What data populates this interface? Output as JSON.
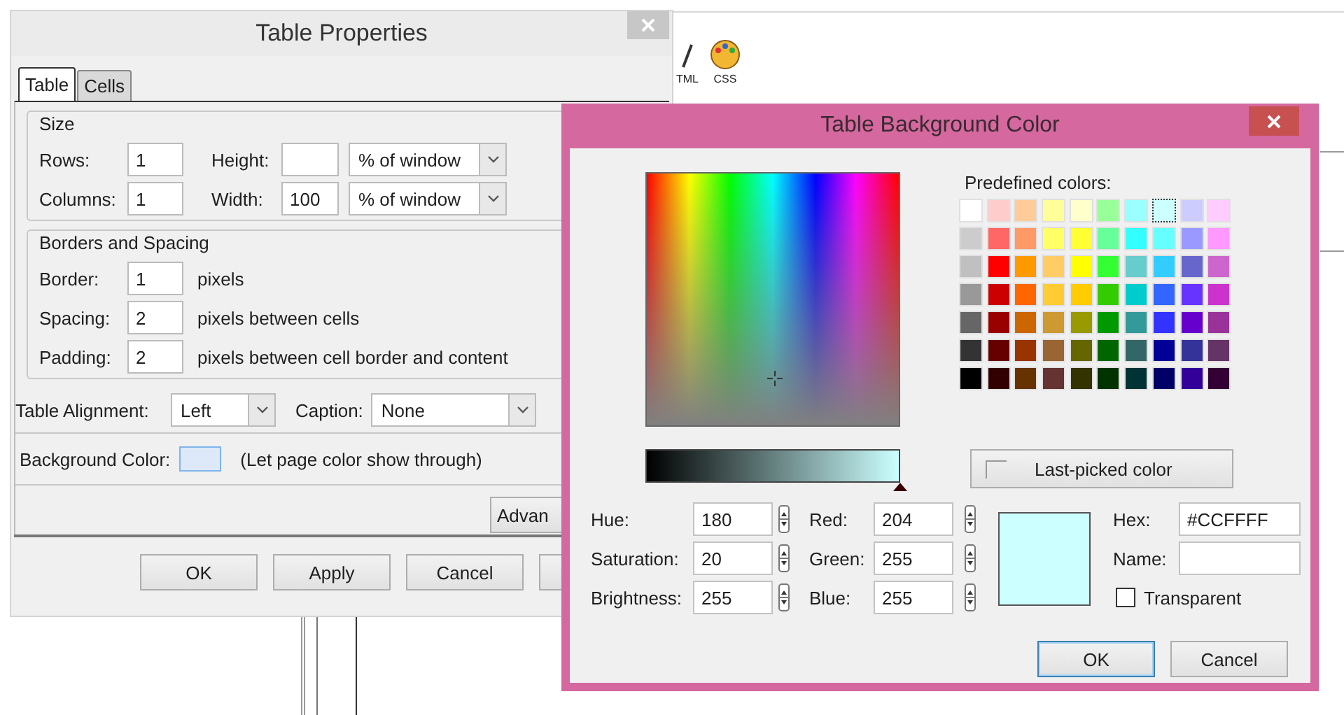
{
  "app": {
    "toolbar": [
      {
        "label": "TML",
        "kind": "html"
      },
      {
        "label": "CSS",
        "kind": "css"
      }
    ]
  },
  "table_properties": {
    "title": "Table Properties",
    "tabs": [
      {
        "label": "Table",
        "selected": true
      },
      {
        "label": "Cells",
        "selected": false
      }
    ],
    "size": {
      "title": "Size",
      "rows": [
        {
          "label": "Rows:",
          "value": "1",
          "dim_label": "Height:",
          "unit": "% of window"
        },
        {
          "label": "Columns:",
          "value": "1",
          "dim_label": "Width:",
          "dim_value": "100",
          "unit": "% of window"
        }
      ]
    },
    "borders": {
      "title": "Borders and Spacing",
      "rows": [
        {
          "label": "Border:",
          "value": "1",
          "note": "pixels"
        },
        {
          "label": "Spacing:",
          "value": "2",
          "note": "pixels between cells"
        },
        {
          "label": "Padding:",
          "value": "2",
          "note": "pixels between cell border and content"
        }
      ]
    },
    "alignment": {
      "label": "Table Alignment:",
      "value": "Left"
    },
    "caption": {
      "label": "Caption:",
      "value": "None"
    },
    "background": {
      "label": "Background Color:",
      "color": "#dde9f8",
      "note": "(Let page color show through)"
    },
    "advanced_button": "Advan",
    "buttons": [
      "OK",
      "Apply",
      "Cancel"
    ]
  },
  "color_dialog": {
    "title": "Table Background Color",
    "predefined_label": "Predefined colors:",
    "swatches": [
      {
        "color": "#ffffff",
        "selected": false
      },
      {
        "color": "#ffcccc",
        "selected": false
      },
      {
        "color": "#ffcc99",
        "selected": false
      },
      {
        "color": "#ffff99",
        "selected": false
      },
      {
        "color": "#ffffcc",
        "selected": false
      },
      {
        "color": "#99ff99",
        "selected": false
      },
      {
        "color": "#99ffff",
        "selected": false
      },
      {
        "color": "#ccffff",
        "selected": true
      },
      {
        "color": "#ccccff",
        "selected": false
      },
      {
        "color": "#ffccff",
        "selected": false
      },
      {
        "color": "#cccccc",
        "selected": false
      },
      {
        "color": "#ff6666",
        "selected": false
      },
      {
        "color": "#ff9966",
        "selected": false
      },
      {
        "color": "#ffff66",
        "selected": false
      },
      {
        "color": "#ffff33",
        "selected": false
      },
      {
        "color": "#66ff99",
        "selected": false
      },
      {
        "color": "#33ffff",
        "selected": false
      },
      {
        "color": "#66ffff",
        "selected": false
      },
      {
        "color": "#9999ff",
        "selected": false
      },
      {
        "color": "#ff99ff",
        "selected": false
      },
      {
        "color": "#c0c0c0",
        "selected": false
      },
      {
        "color": "#ff0000",
        "selected": false
      },
      {
        "color": "#ff9900",
        "selected": false
      },
      {
        "color": "#ffcc66",
        "selected": false
      },
      {
        "color": "#ffff00",
        "selected": false
      },
      {
        "color": "#33ff33",
        "selected": false
      },
      {
        "color": "#66cccc",
        "selected": false
      },
      {
        "color": "#33ccff",
        "selected": false
      },
      {
        "color": "#6666cc",
        "selected": false
      },
      {
        "color": "#cc66cc",
        "selected": false
      },
      {
        "color": "#999999",
        "selected": false
      },
      {
        "color": "#cc0000",
        "selected": false
      },
      {
        "color": "#ff6600",
        "selected": false
      },
      {
        "color": "#ffcc33",
        "selected": false
      },
      {
        "color": "#ffcc00",
        "selected": false
      },
      {
        "color": "#33cc00",
        "selected": false
      },
      {
        "color": "#00cccc",
        "selected": false
      },
      {
        "color": "#3366ff",
        "selected": false
      },
      {
        "color": "#6633ff",
        "selected": false
      },
      {
        "color": "#cc33cc",
        "selected": false
      },
      {
        "color": "#666666",
        "selected": false
      },
      {
        "color": "#990000",
        "selected": false
      },
      {
        "color": "#cc6600",
        "selected": false
      },
      {
        "color": "#cc9933",
        "selected": false
      },
      {
        "color": "#999900",
        "selected": false
      },
      {
        "color": "#009900",
        "selected": false
      },
      {
        "color": "#339999",
        "selected": false
      },
      {
        "color": "#3333ff",
        "selected": false
      },
      {
        "color": "#6600cc",
        "selected": false
      },
      {
        "color": "#993399",
        "selected": false
      },
      {
        "color": "#333333",
        "selected": false
      },
      {
        "color": "#660000",
        "selected": false
      },
      {
        "color": "#993300",
        "selected": false
      },
      {
        "color": "#996633",
        "selected": false
      },
      {
        "color": "#666600",
        "selected": false
      },
      {
        "color": "#006600",
        "selected": false
      },
      {
        "color": "#336666",
        "selected": false
      },
      {
        "color": "#000099",
        "selected": false
      },
      {
        "color": "#333399",
        "selected": false
      },
      {
        "color": "#663366",
        "selected": false
      },
      {
        "color": "#000000",
        "selected": false
      },
      {
        "color": "#330000",
        "selected": false
      },
      {
        "color": "#663300",
        "selected": false
      },
      {
        "color": "#663333",
        "selected": false
      },
      {
        "color": "#333300",
        "selected": false
      },
      {
        "color": "#003300",
        "selected": false
      },
      {
        "color": "#003333",
        "selected": false
      },
      {
        "color": "#000066",
        "selected": false
      },
      {
        "color": "#330099",
        "selected": false
      },
      {
        "color": "#330033",
        "selected": false
      }
    ],
    "brightness": {
      "level": 1
    },
    "last_picked": "Last-picked color",
    "hsb": [
      {
        "label": "Hue:",
        "value": "180"
      },
      {
        "label": "Saturation:",
        "value": "20"
      },
      {
        "label": "Brightness:",
        "value": "255"
      }
    ],
    "rgb": [
      {
        "label": "Red:",
        "value": "204"
      },
      {
        "label": "Green:",
        "value": "255"
      },
      {
        "label": "Blue:",
        "value": "255"
      }
    ],
    "preview": {
      "color": "#ccffff"
    },
    "hex": {
      "label": "Hex:",
      "value": "#CCFFFF"
    },
    "name": {
      "label": "Name:"
    },
    "transparent": {
      "label": "Transparent",
      "checked": false
    },
    "buttons": [
      {
        "label": "OK",
        "default": true
      },
      {
        "label": "Cancel",
        "default": false
      }
    ]
  }
}
